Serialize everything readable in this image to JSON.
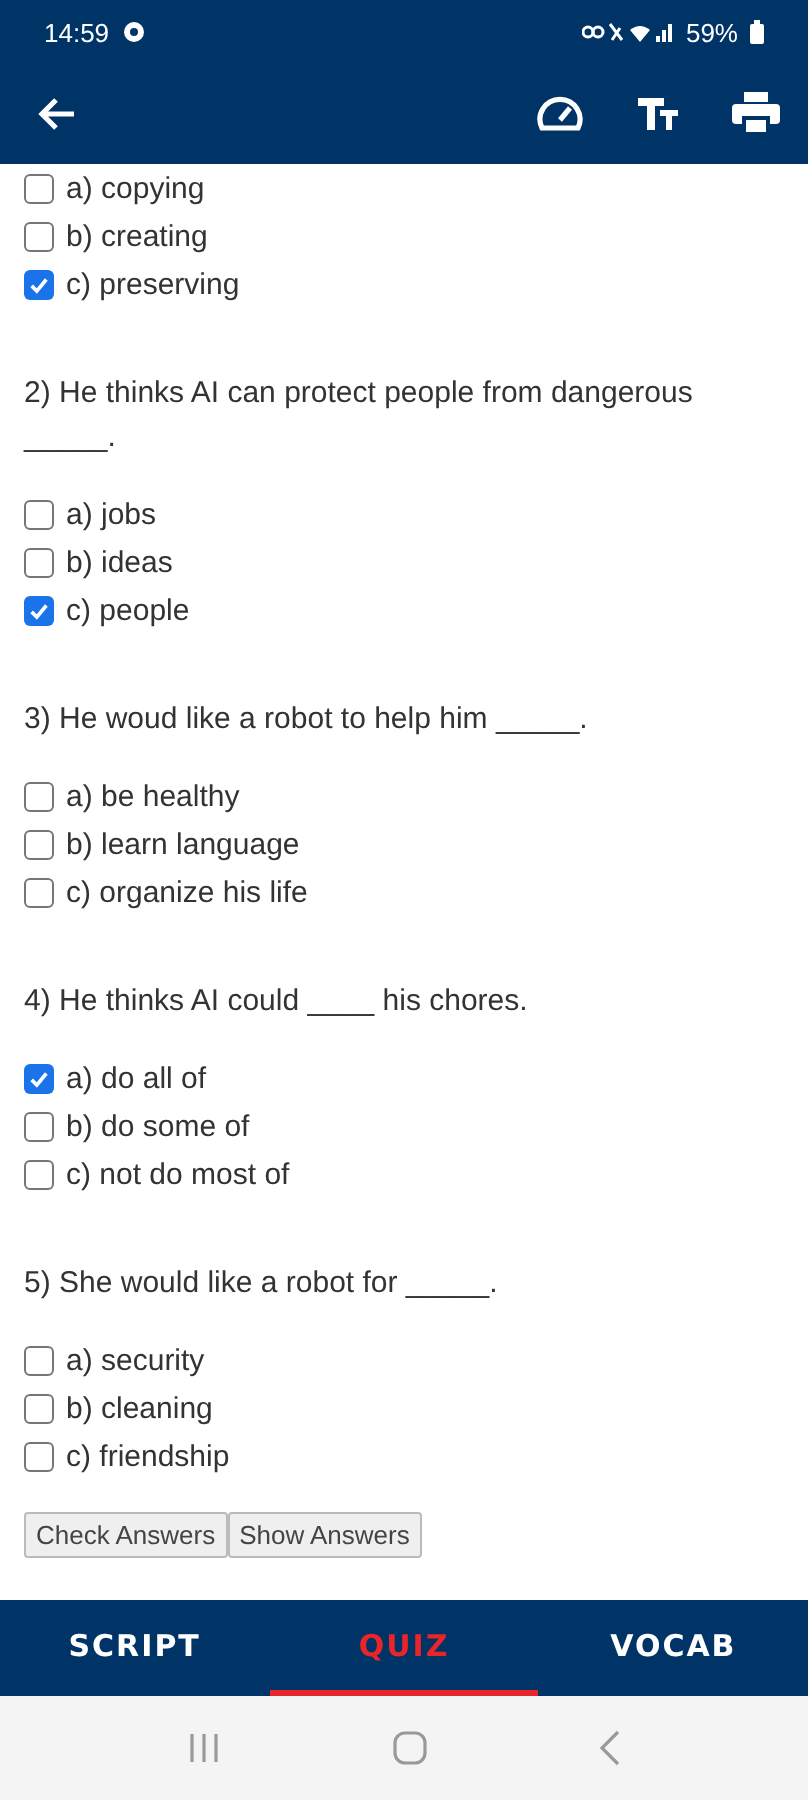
{
  "status_bar": {
    "time": "14:59",
    "battery": "59%"
  },
  "carryover_options": [
    {
      "text": "a) copying",
      "checked": false
    },
    {
      "text": "b) creating",
      "checked": false
    },
    {
      "text": "c) preserving",
      "checked": true
    }
  ],
  "questions": [
    {
      "prompt": "2) He thinks AI can protect people from dangerous _____.",
      "options": [
        {
          "text": "a) jobs",
          "checked": false
        },
        {
          "text": "b) ideas",
          "checked": false
        },
        {
          "text": "c) people",
          "checked": true
        }
      ]
    },
    {
      "prompt": "3) He woud like a robot to help him _____.",
      "options": [
        {
          "text": "a) be healthy",
          "checked": false
        },
        {
          "text": "b) learn language",
          "checked": false
        },
        {
          "text": "c) organize his life",
          "checked": false
        }
      ]
    },
    {
      "prompt": "4) He thinks AI could ____ his chores.",
      "options": [
        {
          "text": "a) do all of",
          "checked": true
        },
        {
          "text": "b) do some of",
          "checked": false
        },
        {
          "text": "c) not do most of",
          "checked": false
        }
      ]
    },
    {
      "prompt": "5) She would like a robot for _____.",
      "options": [
        {
          "text": "a) security",
          "checked": false
        },
        {
          "text": "b) cleaning",
          "checked": false
        },
        {
          "text": "c) friendship",
          "checked": false
        }
      ]
    }
  ],
  "buttons": [
    "Check Answers",
    "Show Answers"
  ],
  "tabs": [
    {
      "label": "SCRIPT",
      "selected": false
    },
    {
      "label": "QUIZ",
      "selected": true
    },
    {
      "label": "VOCAB",
      "selected": false
    }
  ]
}
